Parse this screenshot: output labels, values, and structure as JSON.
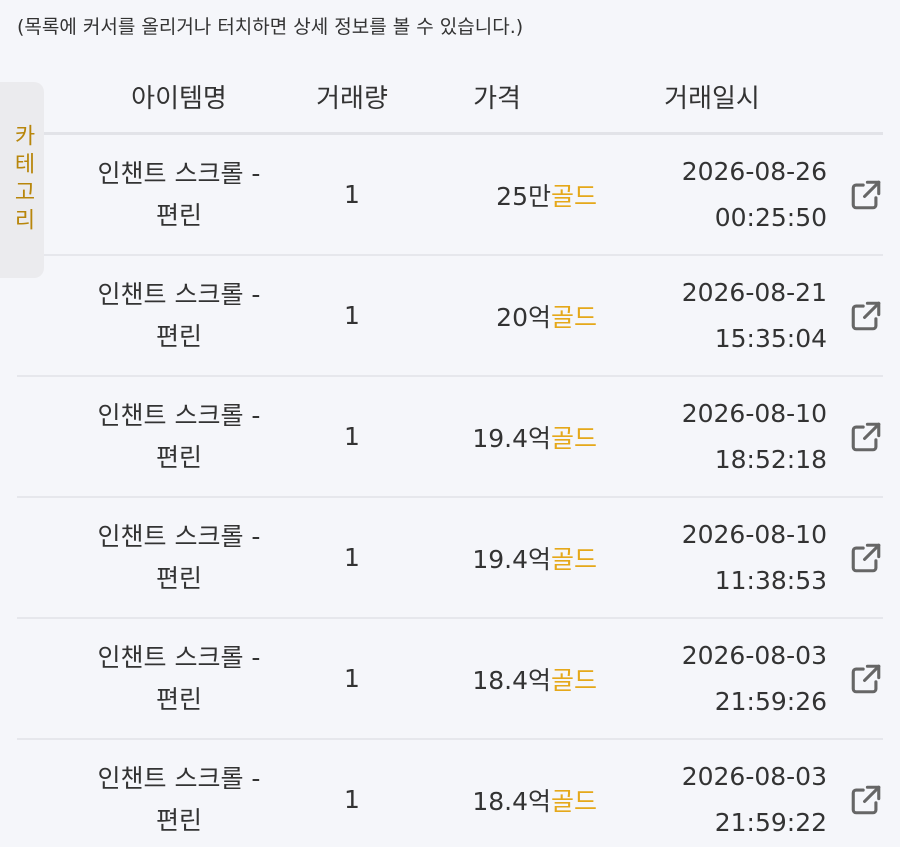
{
  "hint": "(목록에 커서를 올리거나 터치하면 상세 정보를 볼 수 있습니다.)",
  "category_tab": {
    "label": "카테고리"
  },
  "colors": {
    "gold": "#e5a81a",
    "category": "#b8860b",
    "text": "#333333"
  },
  "table": {
    "headers": {
      "name": "아이템명",
      "qty": "거래량",
      "price": "가격",
      "date": "거래일시"
    },
    "rows": [
      {
        "name_line1": "인챈트 스크롤 -",
        "name_line2": "편린",
        "qty": "1",
        "price": "25만",
        "unit": "골드",
        "date": "2026-08-26",
        "time": "00:25:50",
        "link_icon": "external-link-icon"
      },
      {
        "name_line1": "인챈트 스크롤 -",
        "name_line2": "편린",
        "qty": "1",
        "price": "20억",
        "unit": "골드",
        "date": "2026-08-21",
        "time": "15:35:04",
        "link_icon": "external-link-icon"
      },
      {
        "name_line1": "인챈트 스크롤 -",
        "name_line2": "편린",
        "qty": "1",
        "price": "19.4억",
        "unit": "골드",
        "date": "2026-08-10",
        "time": "18:52:18",
        "link_icon": "external-link-icon"
      },
      {
        "name_line1": "인챈트 스크롤 -",
        "name_line2": "편린",
        "qty": "1",
        "price": "19.4억",
        "unit": "골드",
        "date": "2026-08-10",
        "time": "11:38:53",
        "link_icon": "external-link-icon"
      },
      {
        "name_line1": "인챈트 스크롤 -",
        "name_line2": "편린",
        "qty": "1",
        "price": "18.4억",
        "unit": "골드",
        "date": "2026-08-03",
        "time": "21:59:26",
        "link_icon": "external-link-icon"
      },
      {
        "name_line1": "인챈트 스크롤 -",
        "name_line2": "편린",
        "qty": "1",
        "price": "18.4억",
        "unit": "골드",
        "date": "2026-08-03",
        "time": "21:59:22",
        "link_icon": "external-link-icon"
      }
    ]
  }
}
